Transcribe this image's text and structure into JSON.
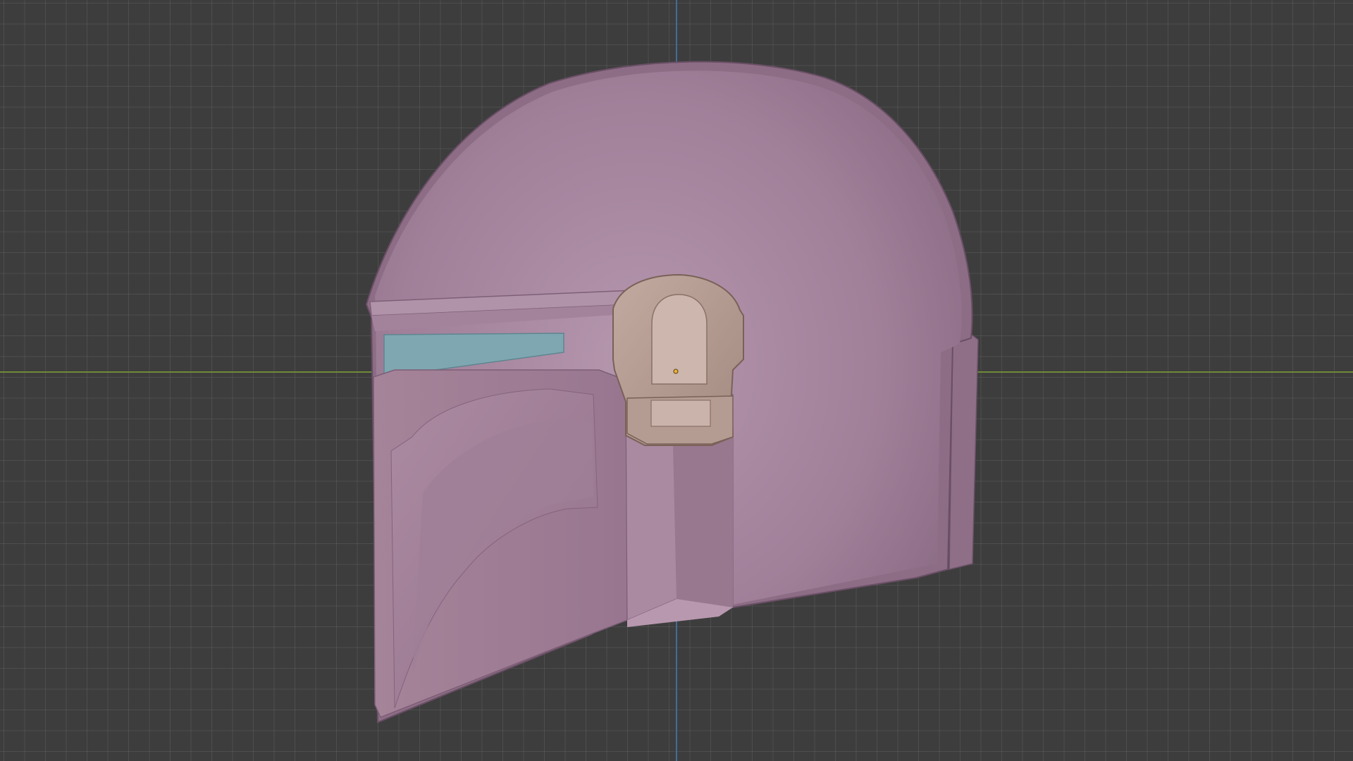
{
  "viewport": {
    "view": "3D viewport",
    "grid": true,
    "axes": [
      "x-axis",
      "y-axis"
    ]
  },
  "colors": {
    "background": "#3d3d3d",
    "grid_line": "#555555",
    "x_axis": "#6e8a3a",
    "y_axis": "#3f6d98",
    "helmet_body": "#a07f99",
    "helmet_light": "#b290ab",
    "helmet_shadow": "#86667f",
    "visor": "#7fa7b1",
    "ear_piece": "#b49a8f",
    "origin_point": "#e8b23a"
  },
  "scene": {
    "object": "helmet-model",
    "parts": [
      "helmet-dome",
      "helmet-faceplate",
      "visor-slit",
      "ear-piece",
      "rear-fin"
    ]
  }
}
